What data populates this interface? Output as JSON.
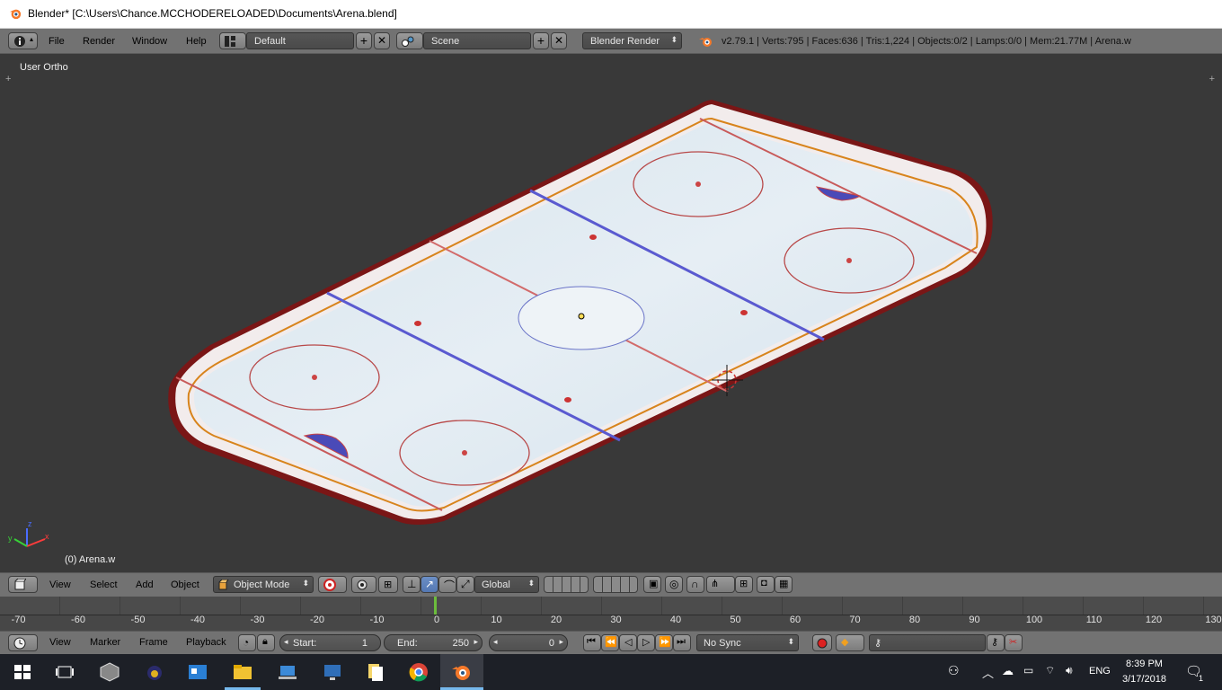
{
  "window": {
    "title": "Blender* [C:\\Users\\Chance.MCCHODERELOADED\\Documents\\Arena.blend]"
  },
  "info_header": {
    "menus": [
      "File",
      "Render",
      "Window",
      "Help"
    ],
    "screen_layout": "Default",
    "scene": "Scene",
    "render_engine": "Blender Render",
    "stats": "v2.79.1 | Verts:795 | Faces:636 | Tris:1,224 | Objects:0/2 | Lamps:0/0 | Mem:21.77M | Arena.w"
  },
  "viewport": {
    "view_name": "User Ortho",
    "active_object": "(0) Arena.w",
    "axes": {
      "x": "x",
      "y": "y",
      "z": "z"
    }
  },
  "view3d_header": {
    "menus": [
      "View",
      "Select",
      "Add",
      "Object"
    ],
    "mode": "Object Mode",
    "orientation": "Global"
  },
  "timeline": {
    "ticks": [
      "-70",
      "-60",
      "-50",
      "-40",
      "-30",
      "-20",
      "-10",
      "0",
      "10",
      "20",
      "30",
      "40",
      "50",
      "60",
      "70",
      "80",
      "90",
      "100",
      "110",
      "120",
      "130"
    ],
    "menus": [
      "View",
      "Marker",
      "Frame",
      "Playback"
    ],
    "start_label": "Start:",
    "start_value": "1",
    "end_label": "End:",
    "end_value": "250",
    "current_frame": "0",
    "sync": "No Sync"
  },
  "taskbar": {
    "language": "ENG",
    "time": "8:39 PM",
    "date": "3/17/2018",
    "notification_count": "1"
  },
  "colors": {
    "accent": "#f5792a",
    "viewport_bg": "#393939",
    "header_bg": "#727272",
    "taskbar_bg": "#1d2027"
  }
}
